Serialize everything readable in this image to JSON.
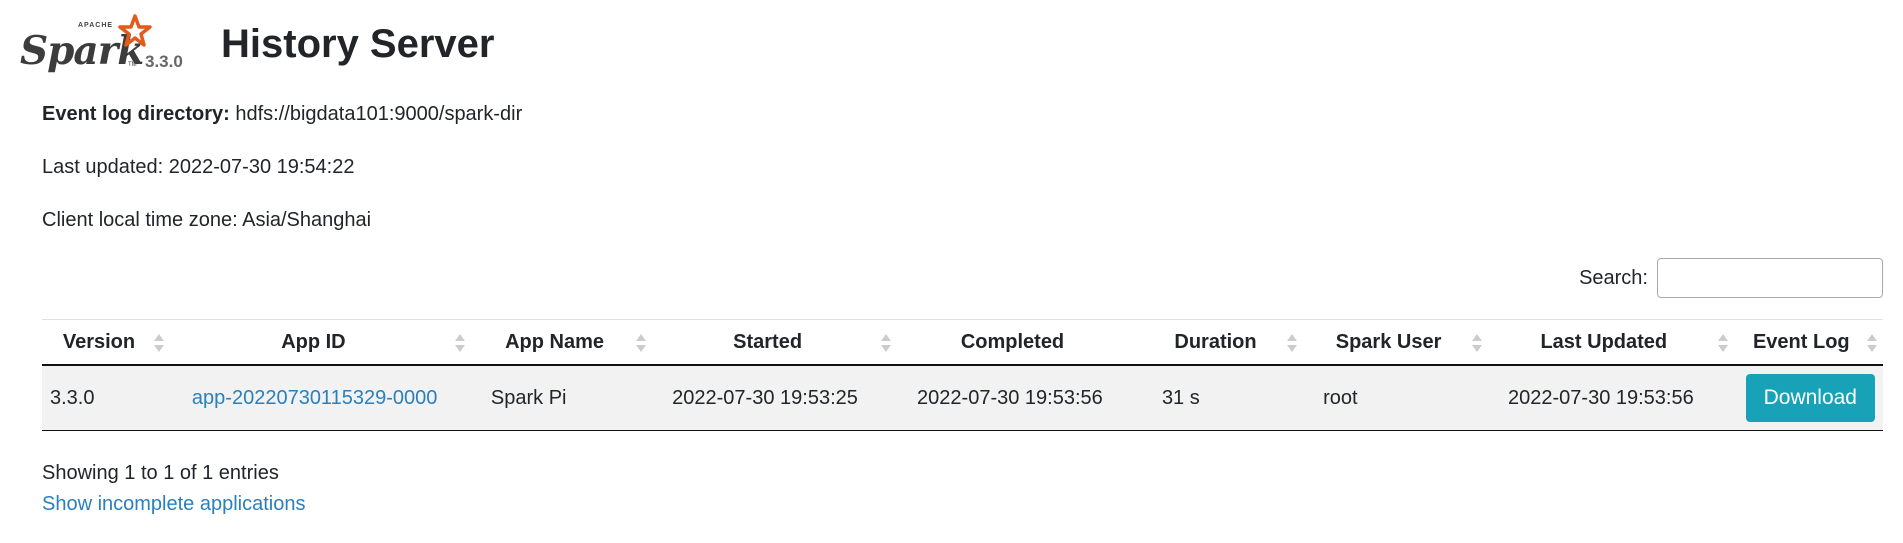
{
  "header": {
    "logo_apache": "APACHE",
    "logo_spark": "Spark",
    "logo_tm": "TM",
    "version": "3.3.0",
    "title": "History Server"
  },
  "info": {
    "event_log_label": "Event log directory:",
    "event_log_value": "hdfs://bigdata101:9000/spark-dir",
    "last_updated": "Last updated: 2022-07-30 19:54:22",
    "time_zone": "Client local time zone: Asia/Shanghai"
  },
  "search": {
    "label": "Search:",
    "value": "",
    "placeholder": ""
  },
  "table": {
    "headers": [
      "Version",
      "App ID",
      "App Name",
      "Started",
      "Completed",
      "Duration",
      "Spark User",
      "Last Updated",
      "Event Log"
    ],
    "rows": [
      {
        "version": "3.3.0",
        "app_id": "app-20220730115329-0000",
        "app_name": "Spark Pi",
        "started": "2022-07-30 19:53:25",
        "completed": "2022-07-30 19:53:56",
        "duration": "31 s",
        "spark_user": "root",
        "last_updated": "2022-07-30 19:53:56",
        "event_log": "Download"
      }
    ]
  },
  "footer": {
    "showing": "Showing 1 to 1 of 1 entries",
    "show_incomplete": "Show incomplete applications"
  },
  "colors": {
    "link": "#2a7fbe",
    "button": "#17a2b8",
    "logo_star": "#e25a1c"
  }
}
